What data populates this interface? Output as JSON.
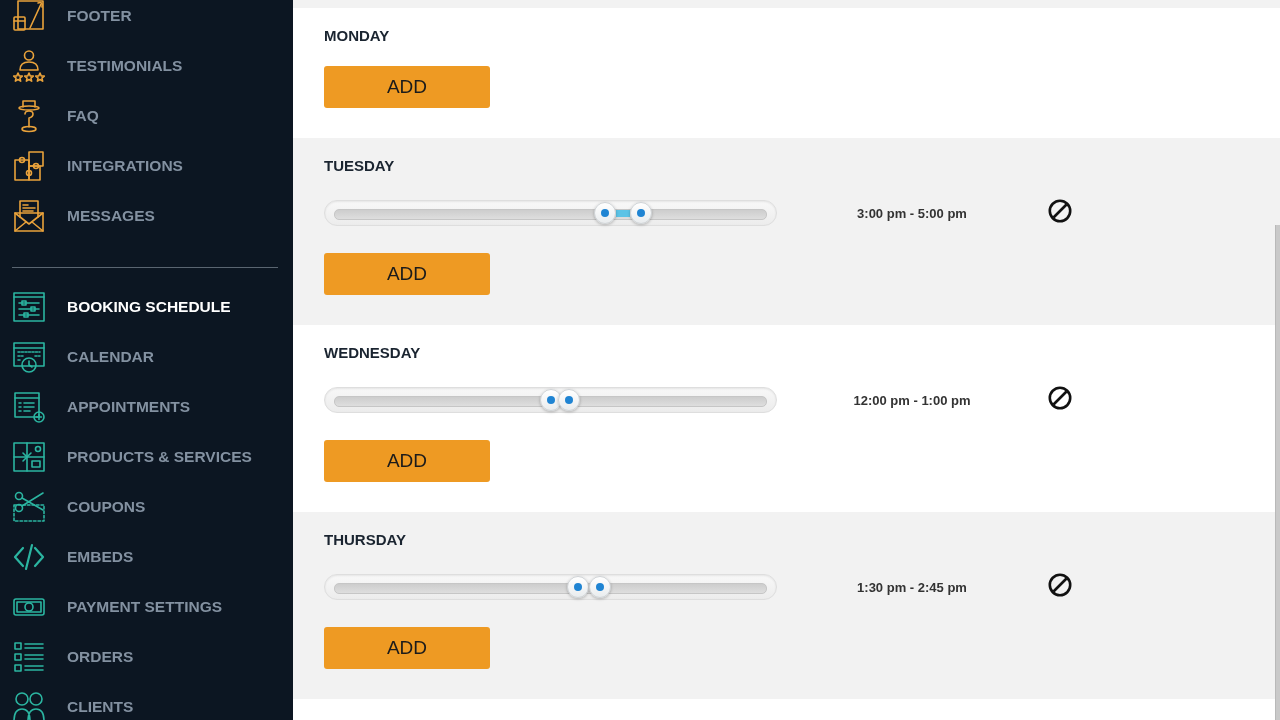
{
  "sidebar": {
    "groups": [
      {
        "items": [
          {
            "label": "FOOTER",
            "selected": false
          },
          {
            "label": "TESTIMONIALS",
            "selected": false
          },
          {
            "label": "FAQ",
            "selected": false
          },
          {
            "label": "INTEGRATIONS",
            "selected": false
          },
          {
            "label": "MESSAGES",
            "selected": false
          }
        ]
      },
      {
        "items": [
          {
            "label": "BOOKING SCHEDULE",
            "selected": true
          },
          {
            "label": "CALENDAR",
            "selected": false
          },
          {
            "label": "APPOINTMENTS",
            "selected": false
          },
          {
            "label": "PRODUCTS & SERVICES",
            "selected": false
          },
          {
            "label": "COUPONS",
            "selected": false
          },
          {
            "label": "EMBEDS",
            "selected": false
          },
          {
            "label": "PAYMENT SETTINGS",
            "selected": false
          },
          {
            "label": "ORDERS",
            "selected": false
          },
          {
            "label": "CLIENTS",
            "selected": false
          }
        ]
      }
    ]
  },
  "schedule": {
    "days": [
      {
        "name": "MONDAY",
        "add_button": "ADD"
      },
      {
        "name": "TUESDAY",
        "slots": [
          {
            "time": "3:00 pm - 5:00 pm",
            "handles": [
              {
                "level": 0.625
              },
              {
                "level": 0.7083
              }
            ]
          }
        ],
        "add_button": "ADD"
      },
      {
        "name": "WEDNESDAY",
        "slots": [
          {
            "time": "12:00 pm - 1:00 pm",
            "handles": [
              {
                "level": 0.5
              },
              {
                "level": 0.5417
              }
            ]
          }
        ],
        "add_button": "ADD"
      },
      {
        "name": "THURSDAY",
        "slots": [
          {
            "time": "1:30 pm - 2:45 pm",
            "handles": [
              {
                "level": 0.5625
              },
              {
                "level": 0.6146
              }
            ]
          }
        ],
        "add_button": "ADD"
      }
    ]
  }
}
